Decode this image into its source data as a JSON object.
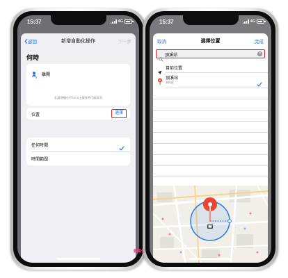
{
  "status": {
    "time": "15:37",
    "network": "4G"
  },
  "left": {
    "nav": {
      "back": "返回",
      "title": "新增自動化操作",
      "next": "下一步"
    },
    "heading": "何時",
    "trigger": {
      "label": "離開"
    },
    "note": "此選項僅在iPhone上操作時可能取消",
    "location": {
      "label": "位置",
      "select": "選擇"
    },
    "options": [
      {
        "label": "任何時間",
        "selected": true
      },
      {
        "label": "時間範圍",
        "selected": false
      }
    ]
  },
  "right": {
    "nav": {
      "cancel": "取消",
      "title": "選擇位置",
      "done": "完成"
    },
    "search": {
      "value": "頂溪站"
    },
    "current_location": "目前位置",
    "result": {
      "name": "頂溪站",
      "subtitle": "永和區",
      "selected": true
    }
  },
  "watermark": "蘋果仁",
  "colors": {
    "accent": "#1a73e8",
    "highlight": "#e02020",
    "pin": "#e8462f"
  },
  "icons": [
    "person-walking-icon",
    "checkmark-icon",
    "search-icon",
    "clear-icon",
    "location-arrow-icon",
    "map-pin-icon"
  ]
}
